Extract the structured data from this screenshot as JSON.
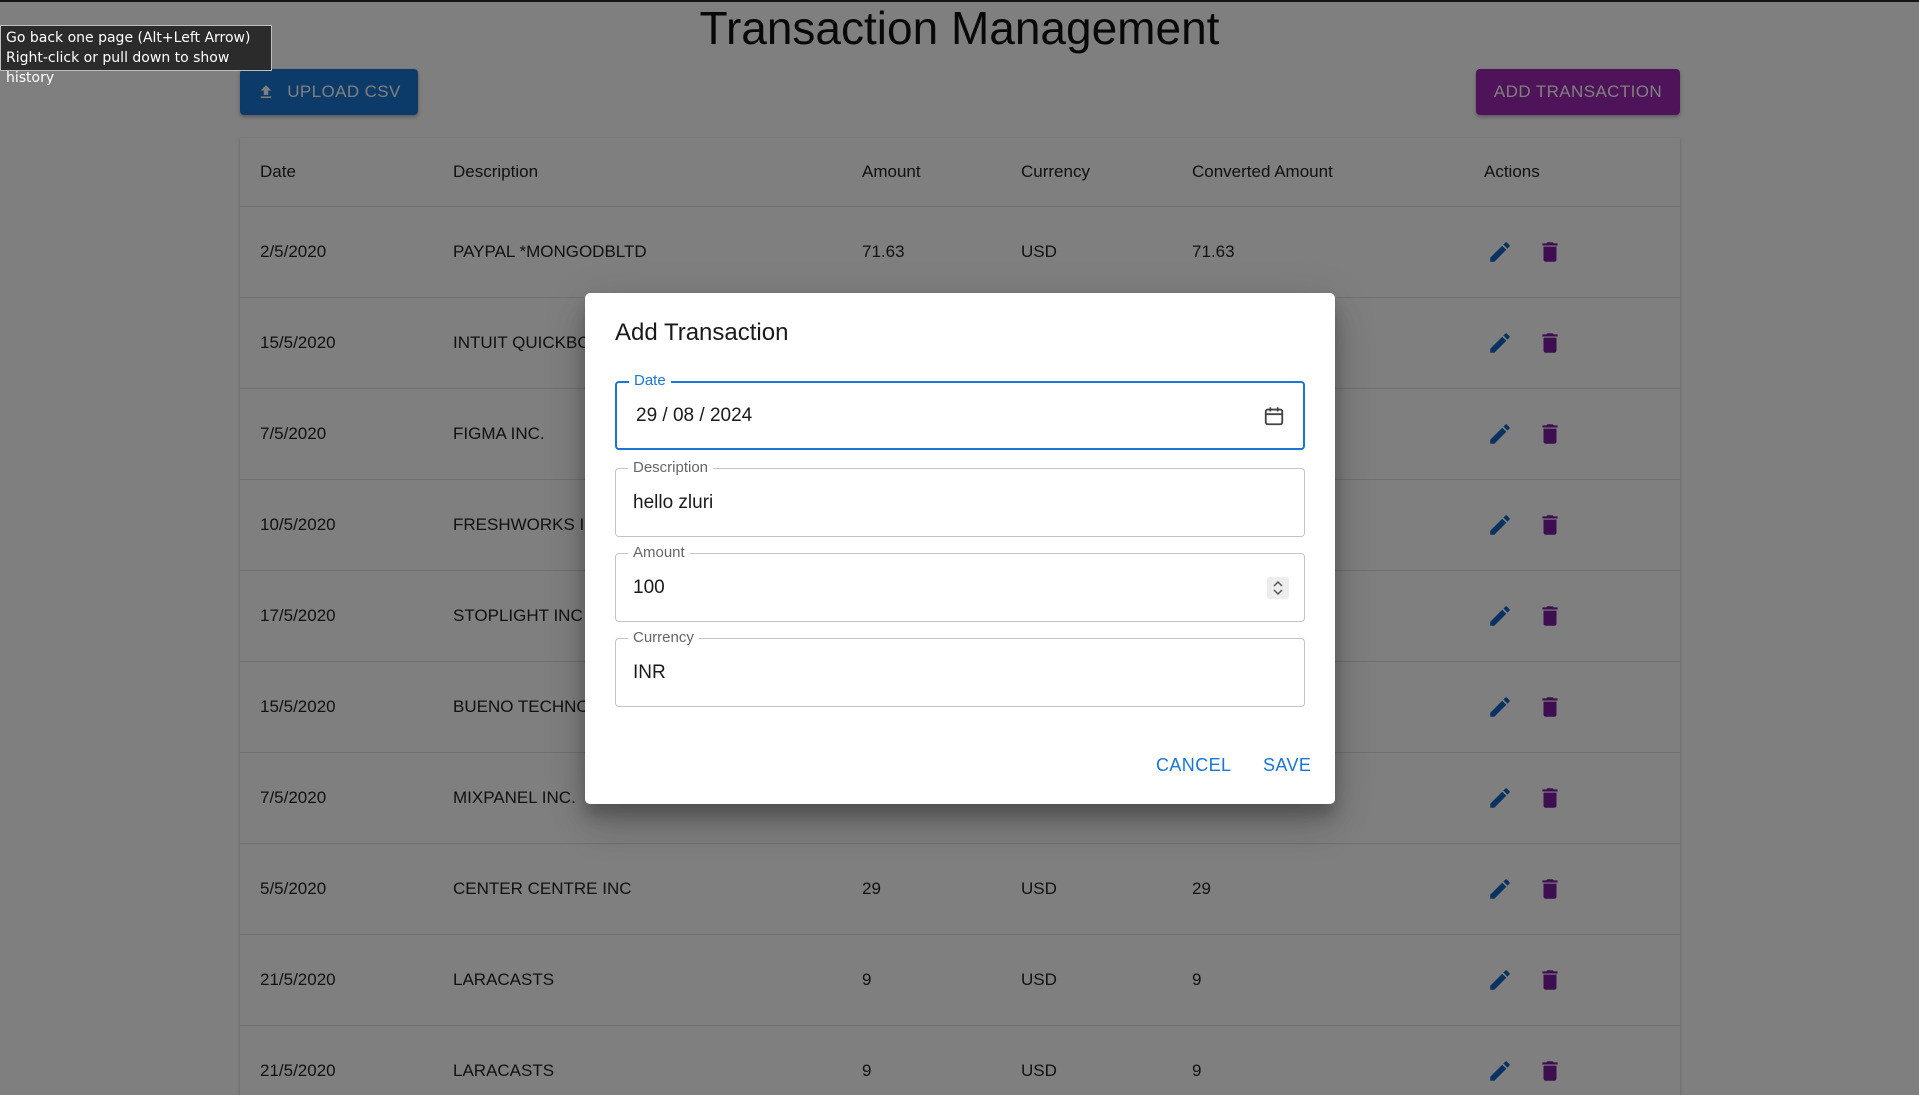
{
  "page": {
    "title": "Transaction Management",
    "upload_label": "UPLOAD CSV",
    "add_label": "ADD TRANSACTION"
  },
  "table": {
    "headers": [
      "Date",
      "Description",
      "Amount",
      "Currency",
      "Converted Amount",
      "Actions"
    ],
    "rows": [
      {
        "date": "2/5/2020",
        "description": "PAYPAL *MONGODBLTD",
        "amount": "71.63",
        "currency": "USD",
        "converted": "71.63"
      },
      {
        "date": "15/5/2020",
        "description": "INTUIT QUICKBOOKS",
        "amount": "",
        "currency": "",
        "converted": ""
      },
      {
        "date": "7/5/2020",
        "description": "FIGMA INC.",
        "amount": "",
        "currency": "",
        "converted": ""
      },
      {
        "date": "10/5/2020",
        "description": "FRESHWORKS INC",
        "amount": "",
        "currency": "",
        "converted": ""
      },
      {
        "date": "17/5/2020",
        "description": "STOPLIGHT INC",
        "amount": "",
        "currency": "",
        "converted": ""
      },
      {
        "date": "15/5/2020",
        "description": "BUENO TECHNOLOGIES",
        "amount": "",
        "currency": "",
        "converted": ""
      },
      {
        "date": "7/5/2020",
        "description": "MIXPANEL INC.",
        "amount": "",
        "currency": "",
        "converted": ""
      },
      {
        "date": "5/5/2020",
        "description": "CENTER CENTRE INC",
        "amount": "29",
        "currency": "USD",
        "converted": "29"
      },
      {
        "date": "21/5/2020",
        "description": "LARACASTS",
        "amount": "9",
        "currency": "USD",
        "converted": "9"
      },
      {
        "date": "21/5/2020",
        "description": "LARACASTS",
        "amount": "9",
        "currency": "USD",
        "converted": "9"
      }
    ]
  },
  "dialog": {
    "title": "Add Transaction",
    "date_label": "Date",
    "date_value": "29 / 08 / 2024",
    "description_label": "Description",
    "description_value": "hello zluri",
    "amount_label": "Amount",
    "amount_value": "100",
    "currency_label": "Currency",
    "currency_value": "INR",
    "cancel_label": "CANCEL",
    "save_label": "SAVE"
  },
  "tooltip": {
    "line1": "Go back one page (Alt+Left Arrow)",
    "line2": "Right-click or pull down to show history"
  },
  "icons": {
    "upload": "upload-icon",
    "edit": "pencil-icon",
    "delete": "trash-icon",
    "calendar": "calendar-icon",
    "stepper": "chevron-updown-icon"
  },
  "colors": {
    "primary": "#1976d2",
    "secondary": "#9c27b0"
  }
}
